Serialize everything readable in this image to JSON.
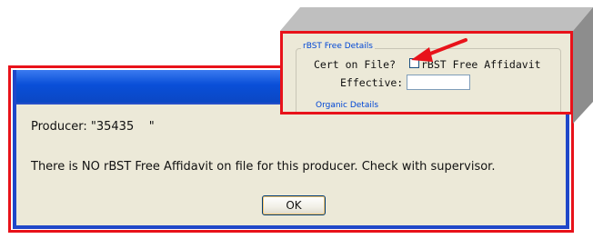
{
  "dialog": {
    "producer_text": "Producer: \"35435    \"",
    "message": "There is NO rBST Free Affidavit on file for this producer.  Check with supervisor.",
    "ok_label": "OK"
  },
  "inset": {
    "group_title": "rBST Free Details",
    "cert_label": "Cert on File?",
    "checkbox_label": "rBST Free Affidavit",
    "effective_label": "Effective:",
    "effective_value": "",
    "next_group_title": "Organic Details"
  },
  "colors": {
    "highlight_red": "#e8121a",
    "title_blue": "#0a4fd8",
    "dialog_bg": "#ece9d8",
    "legend_blue": "#0046d5"
  }
}
